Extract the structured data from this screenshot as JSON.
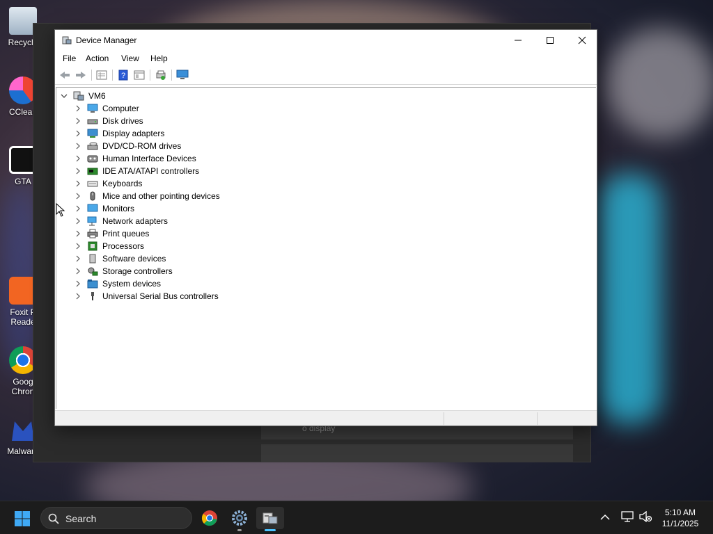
{
  "desktop": {
    "icons": [
      {
        "label": "Recycle",
        "icon": "recycle-bin-icon"
      },
      {
        "label": "CClean",
        "icon": "ccleaner-icon"
      },
      {
        "label": "GTA",
        "icon": "gta-icon"
      },
      {
        "label": "Foxit P Reade",
        "icon": "foxit-reader-icon"
      },
      {
        "label": "Goog Chron",
        "icon": "chrome-icon"
      },
      {
        "label": "Malware",
        "icon": "malwarebytes-icon"
      }
    ],
    "background_window_text": "o display"
  },
  "window": {
    "title": "Device Manager",
    "menu": [
      "File",
      "Action",
      "View",
      "Help"
    ],
    "toolbar": [
      "back-icon",
      "forward-icon",
      "properties-icon",
      "help-icon",
      "view-icon",
      "update-driver-icon",
      "monitor-icon"
    ]
  },
  "tree": {
    "root": "VM6",
    "items": [
      {
        "label": "Computer",
        "icon": "computer-icon"
      },
      {
        "label": "Disk drives",
        "icon": "disk-drive-icon"
      },
      {
        "label": "Display adapters",
        "icon": "display-adapter-icon"
      },
      {
        "label": "DVD/CD-ROM drives",
        "icon": "dvd-drive-icon"
      },
      {
        "label": "Human Interface Devices",
        "icon": "hid-icon"
      },
      {
        "label": "IDE ATA/ATAPI controllers",
        "icon": "ide-controller-icon"
      },
      {
        "label": "Keyboards",
        "icon": "keyboard-icon"
      },
      {
        "label": "Mice and other pointing devices",
        "icon": "mouse-icon"
      },
      {
        "label": "Monitors",
        "icon": "monitor-icon"
      },
      {
        "label": "Network adapters",
        "icon": "network-adapter-icon"
      },
      {
        "label": "Print queues",
        "icon": "printer-icon"
      },
      {
        "label": "Processors",
        "icon": "processor-icon"
      },
      {
        "label": "Software devices",
        "icon": "software-device-icon"
      },
      {
        "label": "Storage controllers",
        "icon": "storage-controller-icon"
      },
      {
        "label": "System devices",
        "icon": "system-devices-icon"
      },
      {
        "label": "Universal Serial Bus controllers",
        "icon": "usb-icon"
      }
    ]
  },
  "taskbar": {
    "search_label": "Search",
    "apps": [
      "chrome-icon",
      "settings-icon",
      "device-manager-icon"
    ],
    "time": "5:10 AM",
    "date": "11/1/2025"
  },
  "colors": {
    "accent": "#0078d4",
    "taskbar": "#1c1c1c",
    "window_bg": "#ffffff"
  }
}
